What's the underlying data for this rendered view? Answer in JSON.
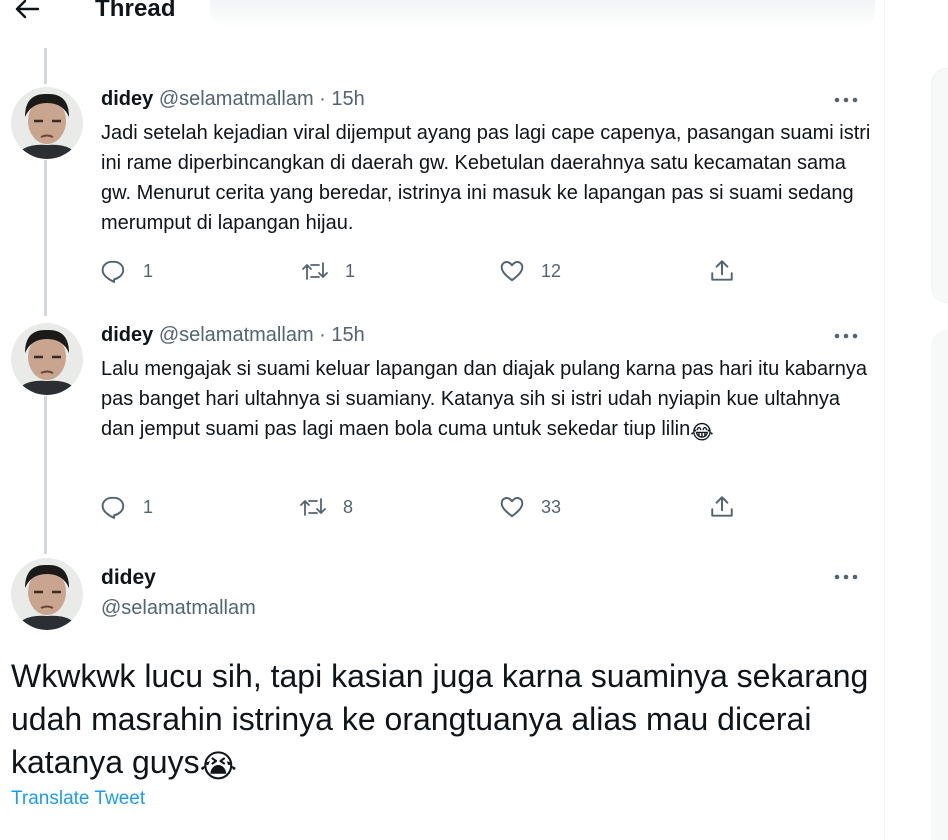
{
  "header": {
    "title": "Thread",
    "back_icon": "arrow-left-icon"
  },
  "tweets": [
    {
      "name": "didey",
      "handle": "@selamatmallam",
      "separator": "·",
      "time": "15h",
      "text": "Jadi setelah kejadian viral dijemput ayang  pas lagi cape capenya, pasangan suami istri ini rame diperbincangkan di daerah gw. Kebetulan daerahnya satu kecamatan sama gw. Menurut cerita yang beredar, istrinya ini masuk ke lapangan pas si suami sedang merumput di lapangan hijau.",
      "replies": "1",
      "retweets": "1",
      "likes": "12"
    },
    {
      "name": "didey",
      "handle": "@selamatmallam",
      "separator": "·",
      "time": "15h",
      "text": "Lalu mengajak si suami keluar lapangan dan diajak pulang karna pas hari itu kabarnya pas banget hari ultahnya si suamiany. Katanya sih si istri udah nyiapin kue ultahnya dan jemput suami pas lagi maen bola cuma untuk sekedar tiup lilin",
      "emoji": "😂",
      "replies": "1",
      "retweets": "8",
      "likes": "33"
    }
  ],
  "main_tweet": {
    "name": "didey",
    "handle": "@selamatmallam",
    "text": "Wkwkwk lucu sih, tapi kasian juga karna suaminya sekarang udah masrahin istrinya ke orangtuanya alias mau dicerai katanya guys",
    "emoji": "😭",
    "translate_label": "Translate Tweet"
  },
  "colors": {
    "accent": "#1d9bf0",
    "secondary_text": "#536471",
    "thread_line": "#cfd9de"
  },
  "icons": [
    "arrow-left-icon",
    "more-icon",
    "reply-icon",
    "retweet-icon",
    "like-icon",
    "share-icon"
  ]
}
